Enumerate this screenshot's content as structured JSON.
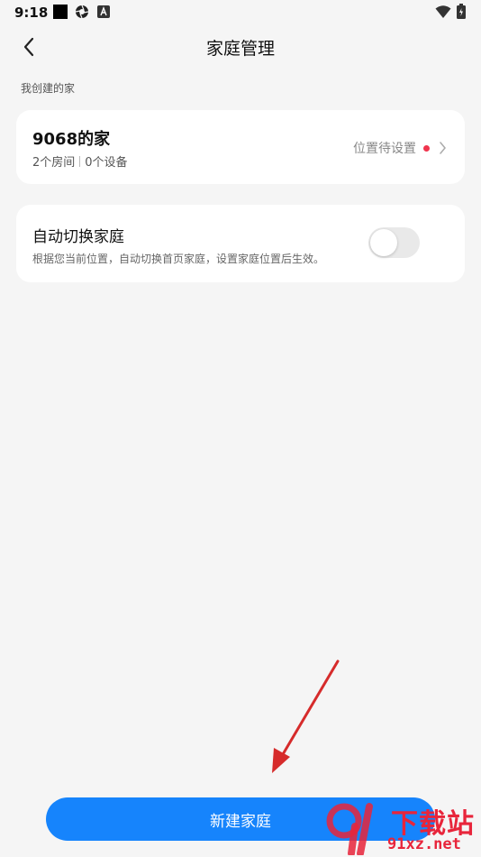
{
  "status_bar": {
    "time": "9:18",
    "icons": [
      "square-icon",
      "aperture-icon",
      "a-box-icon",
      "wifi-icon",
      "battery-icon"
    ]
  },
  "header": {
    "title": "家庭管理",
    "back_icon": "chevron-left-icon"
  },
  "section": {
    "label": "我创建的家"
  },
  "home_card": {
    "name": "9068的家",
    "rooms": "2个房间",
    "devices": "0个设备",
    "location_status": "位置待设置",
    "status_color": "#f0344d"
  },
  "auto_switch": {
    "title": "自动切换家庭",
    "description": "根据您当前位置，自动切换首页家庭，设置家庭位置后生效。",
    "enabled": false
  },
  "footer": {
    "new_home_label": "新建家庭",
    "accent": "#1684fc"
  },
  "watermark": {
    "line1": "下载站",
    "line2": "91xz.net"
  }
}
